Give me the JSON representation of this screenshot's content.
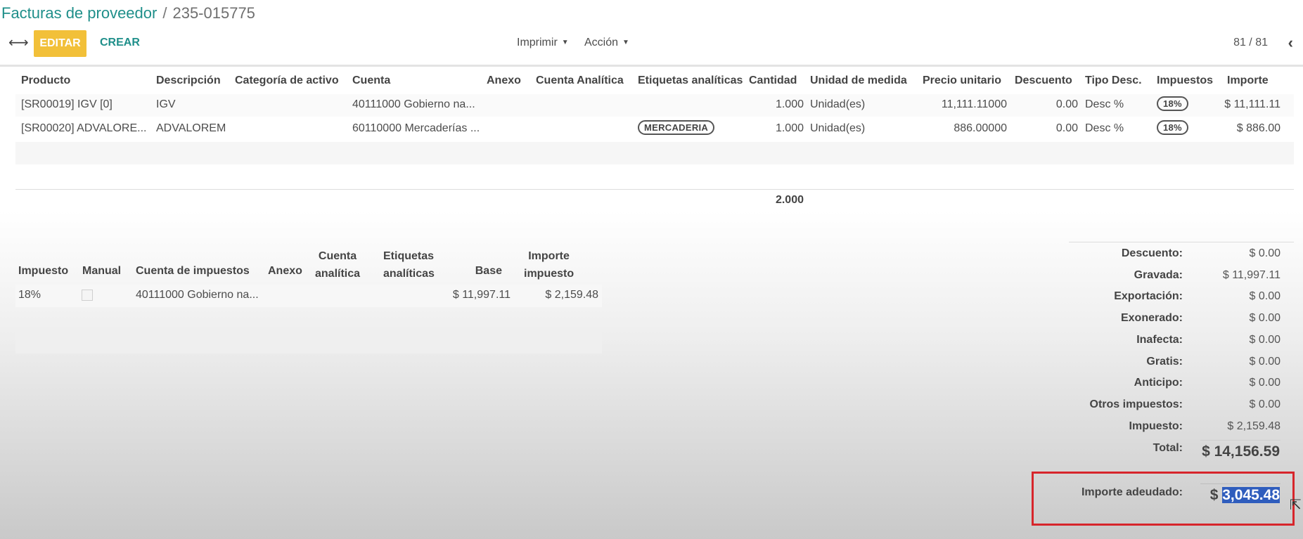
{
  "breadcrumb": {
    "parent": "Facturas de proveedor",
    "separator": "/",
    "current": "235-015775"
  },
  "toolbar": {
    "edit_label": "EDITAR",
    "create_label": "CREAR",
    "print_label": "Imprimir",
    "action_label": "Acción",
    "pager": "81 / 81"
  },
  "lines_table": {
    "headers": [
      "Producto",
      "Descripción",
      "Categoría de activo",
      "Cuenta",
      "Anexo",
      "Cuenta Analítica",
      "Etiquetas analíticas",
      "Cantidad",
      "Unidad de medida",
      "Precio unitario",
      "Descuento",
      "Tipo Desc.",
      "Impuestos",
      "Importe"
    ],
    "rows": [
      {
        "producto": "[SR00019] IGV [0]",
        "descripcion": "IGV",
        "cuenta": "40111000 Gobierno na...",
        "etiqueta": "",
        "cantidad": "1.000",
        "unidad": "Unidad(es)",
        "precio": "11,111.11000",
        "descuento": "0.00",
        "tipo_desc": "Desc %",
        "impuesto": "18%",
        "importe": "$ 11,111.11"
      },
      {
        "producto": "[SR00020] ADVALORE...",
        "descripcion": "ADVALOREM",
        "cuenta": "60110000 Mercaderías ...",
        "etiqueta": "MERCADERIA",
        "cantidad": "1.000",
        "unidad": "Unidad(es)",
        "precio": "886.00000",
        "descuento": "0.00",
        "tipo_desc": "Desc %",
        "impuesto": "18%",
        "importe": "$ 886.00"
      }
    ],
    "total_quantity": "2.000"
  },
  "tax_table": {
    "headers": {
      "impuesto": "Impuesto",
      "manual": "Manual",
      "cuenta_impuestos": "Cuenta de impuestos",
      "anexo": "Anexo",
      "cuenta_analitica_1": "Cuenta",
      "cuenta_analitica_2": "analítica",
      "etiquetas_1": "Etiquetas",
      "etiquetas_2": "analíticas",
      "base": "Base",
      "importe_1": "Importe",
      "importe_2": "impuesto"
    },
    "rows": [
      {
        "impuesto": "18%",
        "cuenta": "40111000 Gobierno na...",
        "base": "$ 11,997.11",
        "importe": "$ 2,159.48"
      }
    ]
  },
  "totals": [
    {
      "label": "Descuento:",
      "value": "$ 0.00"
    },
    {
      "label": "Gravada:",
      "value": "$ 11,997.11"
    },
    {
      "label": "Exportación:",
      "value": "$ 0.00"
    },
    {
      "label": "Exonerado:",
      "value": "$ 0.00"
    },
    {
      "label": "Inafecta:",
      "value": "$ 0.00"
    },
    {
      "label": "Gratis:",
      "value": "$ 0.00"
    },
    {
      "label": "Anticipo:",
      "value": "$ 0.00"
    },
    {
      "label": "Otros impuestos:",
      "value": "$ 0.00"
    },
    {
      "label": "Impuesto:",
      "value": "$ 2,159.48"
    }
  ],
  "grand_total": {
    "label": "Total:",
    "value": "$ 14,156.59"
  },
  "amount_due": {
    "label": "Importe adeudado:",
    "currency": "$",
    "amount": "3,045.48"
  },
  "colors": {
    "accent": "#1f8f8a",
    "edit_button": "#f2c039",
    "highlight_border": "#d7252b",
    "selection": "#2f5dbd"
  }
}
